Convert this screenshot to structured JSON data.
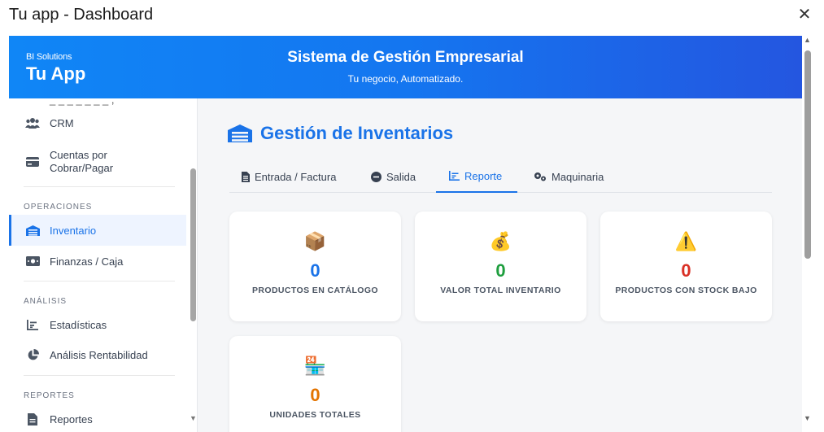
{
  "window": {
    "title": "Tu app - Dashboard",
    "close_glyph": "✕"
  },
  "header": {
    "brand_small": "BI Solutions",
    "brand_big": "Tu App",
    "title": "Sistema de Gestión Empresarial",
    "subtitle": "Tu negocio, Automatizado."
  },
  "sidebar": {
    "items": [
      {
        "label": "CRM",
        "icon": "users-icon"
      },
      {
        "label": "Cuentas por Cobrar/Pagar",
        "icon": "credit-card-icon"
      },
      {
        "label": "Inventario",
        "icon": "warehouse-icon",
        "active": true
      },
      {
        "label": "Finanzas / Caja",
        "icon": "money-bill-icon"
      },
      {
        "label": "Estadísticas",
        "icon": "bar-chart-icon"
      },
      {
        "label": "Análisis Rentabilidad",
        "icon": "pie-chart-icon"
      },
      {
        "label": "Reportes",
        "icon": "file-icon"
      }
    ],
    "sections": {
      "operaciones": "OPERACIONES",
      "analisis": "ANÁLISIS",
      "reportes": "REPORTES"
    }
  },
  "main": {
    "title": "Gestión de Inventarios",
    "tabs": [
      {
        "label": "Entrada / Factura",
        "icon": "file-invoice-icon"
      },
      {
        "label": "Salida",
        "icon": "minus-circle-icon"
      },
      {
        "label": "Reporte",
        "icon": "chart-line-icon",
        "active": true
      },
      {
        "label": "Maquinaria",
        "icon": "cogs-icon"
      }
    ],
    "cards": [
      {
        "emoji": "📦",
        "value": "0",
        "label": "PRODUCTOS EN CATÁLOGO",
        "color": "#1a73e8"
      },
      {
        "emoji": "💰",
        "value": "0",
        "label": "VALOR TOTAL INVENTARIO",
        "color": "#1e9e3e"
      },
      {
        "emoji": "⚠️",
        "value": "0",
        "label": "PRODUCTOS CON STOCK BAJO",
        "color": "#d93025"
      },
      {
        "emoji": "🏪",
        "value": "0",
        "label": "UNIDADES TOTALES",
        "color": "#e37400"
      }
    ]
  },
  "colors": {
    "accent": "#1a73e8",
    "header_start": "#1086f6",
    "header_end": "#2456e0"
  }
}
